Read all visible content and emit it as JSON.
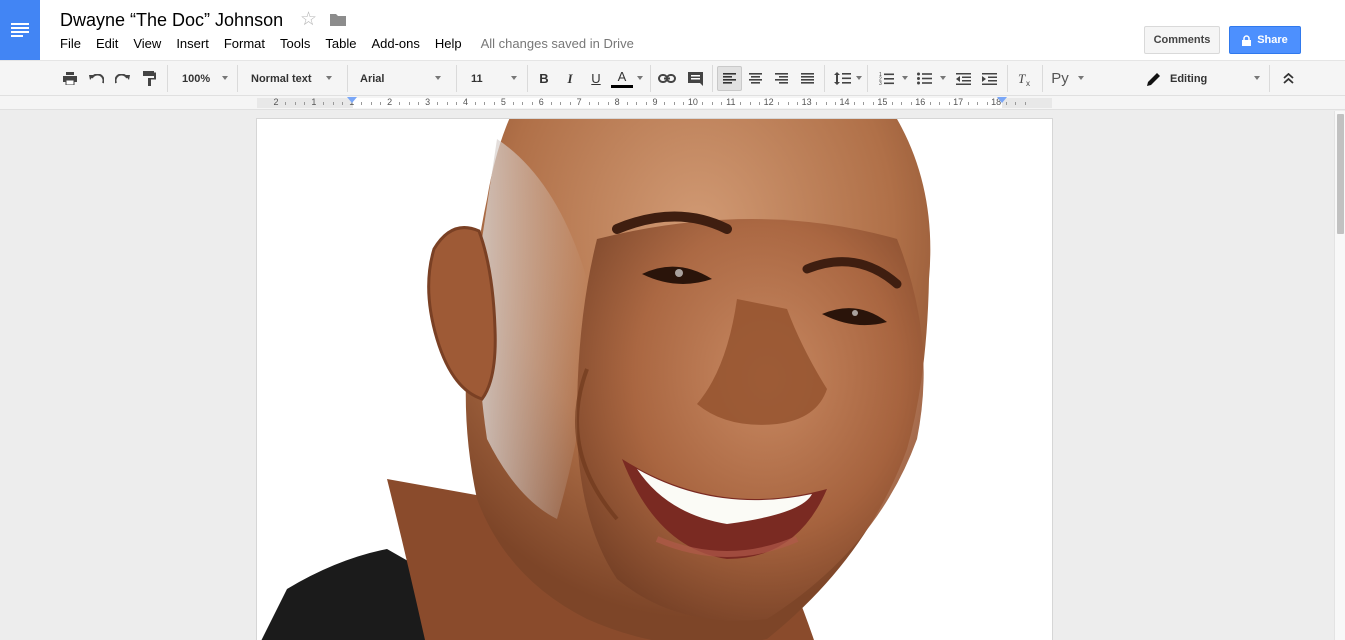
{
  "app": {
    "doc_title": "Dwayne “The Doc” Johnson",
    "save_status": "All changes saved in Drive",
    "menu": [
      "File",
      "Edit",
      "View",
      "Insert",
      "Format",
      "Tools",
      "Table",
      "Add-ons",
      "Help"
    ],
    "comments_label": "Comments",
    "share_label": "Share",
    "colors": {
      "brand_blue": "#4285f4",
      "share_blue": "#4d90fe",
      "text_color_bar": "#000000"
    }
  },
  "toolbar": {
    "zoom": "100%",
    "style": "Normal text",
    "font": "Arial",
    "size": "11",
    "bold": "B",
    "italic": "I",
    "underline": "U",
    "text_color": "A",
    "input_tools": "Py",
    "mode": "Editing",
    "icons": [
      "print-icon",
      "undo-icon",
      "redo-icon",
      "paint-format-icon",
      "link-icon",
      "comment-icon",
      "align-left-icon",
      "align-center-icon",
      "align-right-icon",
      "align-justify-icon",
      "line-spacing-icon",
      "numbered-list-icon",
      "bulleted-list-icon",
      "decrease-indent-icon",
      "increase-indent-icon",
      "clear-formatting-icon",
      "pencil-icon",
      "collapse-icon"
    ]
  },
  "ruler": {
    "labels": [
      "2",
      "1",
      "1",
      "2",
      "3",
      "4",
      "5",
      "6",
      "7",
      "8",
      "9",
      "10",
      "11",
      "12",
      "13",
      "14",
      "15",
      "16",
      "17",
      "18"
    ]
  },
  "document": {
    "content": "photo of a smiling bald man (face close-up)"
  }
}
